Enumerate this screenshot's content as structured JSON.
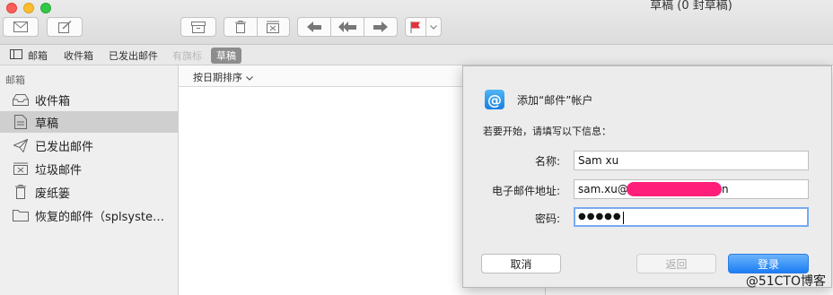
{
  "window": {
    "title": "草稿 (0 封草稿)"
  },
  "toolbar": {
    "buttons": [
      {
        "name": "get-mail-button",
        "icon": "envelope-icon"
      },
      {
        "name": "compose-button",
        "icon": "compose-icon"
      },
      {
        "name": "archive-button",
        "icon": "archive-icon"
      },
      {
        "name": "delete-button",
        "icon": "trash-icon"
      },
      {
        "name": "junk-button",
        "icon": "junk-icon"
      },
      {
        "name": "reply-button",
        "icon": "reply-icon"
      },
      {
        "name": "reply-all-button",
        "icon": "reply-all-icon"
      },
      {
        "name": "forward-button",
        "icon": "forward-icon"
      },
      {
        "name": "flag-button",
        "icon": "flag-icon"
      }
    ],
    "flag_color": "#e0323b"
  },
  "favorites": {
    "mailboxes": "邮箱",
    "inbox": "收件箱",
    "sent": "已发出邮件",
    "flagged": "有旗标",
    "drafts": "草稿"
  },
  "sidebar": {
    "heading": "邮箱",
    "items": [
      {
        "label": "收件箱",
        "icon": "inbox-icon"
      },
      {
        "label": "草稿",
        "icon": "draft-icon",
        "selected": true
      },
      {
        "label": "已发出邮件",
        "icon": "sent-icon"
      },
      {
        "label": "垃圾邮件",
        "icon": "junk-icon"
      },
      {
        "label": "废纸篓",
        "icon": "trash-icon"
      },
      {
        "label": "恢复的邮件（splsyste…",
        "icon": "folder-icon"
      }
    ]
  },
  "sort": {
    "label": "按日期排序"
  },
  "dialog": {
    "title": "添加“邮件”帐户",
    "subtitle": "若要开始，请填写以下信息：",
    "name_label": "名称:",
    "name_value": "Sam xu",
    "email_label": "电子邮件地址:",
    "email_prefix": "sam.xu@",
    "email_suffix": "n",
    "password_label": "密码:",
    "password_mask": "●●●●●",
    "cancel": "取消",
    "back": "返回",
    "login": "登录",
    "accent": "#1b7df5"
  },
  "watermark": "@51CTO博客"
}
